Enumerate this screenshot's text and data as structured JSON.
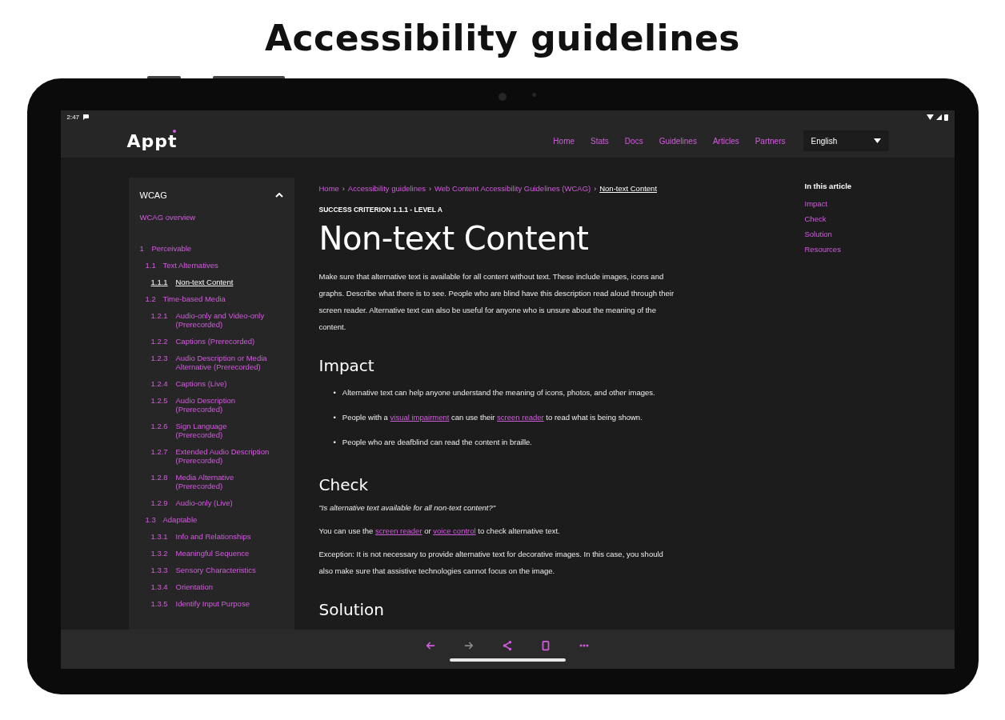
{
  "page_title": "Accessibility guidelines",
  "status_bar": {
    "time": "2:47"
  },
  "header": {
    "logo": "Appt",
    "nav": [
      {
        "label": "Home"
      },
      {
        "label": "Stats"
      },
      {
        "label": "Docs"
      },
      {
        "label": "Guidelines"
      },
      {
        "label": "Articles"
      },
      {
        "label": "Partners"
      }
    ],
    "language": {
      "value": "English"
    }
  },
  "sidebar": {
    "title": "WCAG",
    "expanded": true,
    "overview": {
      "label": "WCAG overview",
      "selected": false
    },
    "items": [
      {
        "number": "1",
        "label": "Perceivable",
        "selected": false,
        "children": [
          {
            "number": "1.1",
            "label": "Text Alternatives",
            "selected": false,
            "children": [
              {
                "number": "1.1.1",
                "label": "Non-text Content",
                "selected": true
              }
            ]
          },
          {
            "number": "1.2",
            "label": "Time-based Media",
            "selected": false,
            "children": [
              {
                "number": "1.2.1",
                "label": "Audio-only and Video-only (Prerecorded)",
                "selected": false
              },
              {
                "number": "1.2.2",
                "label": "Captions (Prerecorded)",
                "selected": false
              },
              {
                "number": "1.2.3",
                "label": "Audio Description or Media Alternative (Prerecorded)",
                "selected": false
              },
              {
                "number": "1.2.4",
                "label": "Captions (Live)",
                "selected": false
              },
              {
                "number": "1.2.5",
                "label": "Audio Description (Prerecorded)",
                "selected": false
              },
              {
                "number": "1.2.6",
                "label": "Sign Language (Prerecorded)",
                "selected": false
              },
              {
                "number": "1.2.7",
                "label": "Extended Audio Description (Prerecorded)",
                "selected": false
              },
              {
                "number": "1.2.8",
                "label": "Media Alternative (Prerecorded)",
                "selected": false
              },
              {
                "number": "1.2.9",
                "label": "Audio-only (Live)",
                "selected": false
              }
            ]
          },
          {
            "number": "1.3",
            "label": "Adaptable",
            "selected": false,
            "children": [
              {
                "number": "1.3.1",
                "label": "Info and Relationships",
                "selected": false
              },
              {
                "number": "1.3.2",
                "label": "Meaningful Sequence",
                "selected": false
              },
              {
                "number": "1.3.3",
                "label": "Sensory Characteristics",
                "selected": false
              },
              {
                "number": "1.3.4",
                "label": "Orientation",
                "selected": false
              },
              {
                "number": "1.3.5",
                "label": "Identify Input Purpose",
                "selected": false
              }
            ]
          }
        ]
      }
    ]
  },
  "breadcrumb": [
    {
      "label": "Home",
      "current": false
    },
    {
      "separator": "›",
      "label": "Accessibility guidelines",
      "current": false
    },
    {
      "separator": "›",
      "label": "Web Content Accessibility Guidelines (WCAG)",
      "current": false
    },
    {
      "separator": "›",
      "label": "Non-text Content",
      "current": true
    }
  ],
  "eyebrow": "SUCCESS CRITERION 1.1.1 - LEVEL A",
  "title": "Non-text Content",
  "blocks": [
    {
      "kind": "paragraph",
      "parts": [
        {
          "text": "Make sure that alternative text is available for all content without text. These include images, icons and graphs. Describe what there is to see. People who are blind have this description read aloud through their screen reader. Alternative text can also be useful for anyone who is unsure about the meaning of the content.",
          "link": false
        }
      ]
    },
    {
      "kind": "heading",
      "text": "Impact"
    },
    {
      "kind": "bullets",
      "items": [
        {
          "marker": "•",
          "parts": [
            {
              "text": "Alternative text can help anyone understand the meaning of icons, photos, and other images.",
              "link": false
            }
          ]
        },
        {
          "marker": "•",
          "parts": [
            {
              "text": "People with a ",
              "link": false
            },
            {
              "text": "visual impairment",
              "link": true
            },
            {
              "text": " can use their ",
              "link": false
            },
            {
              "text": "screen reader",
              "link": true
            },
            {
              "text": " to read what is being shown.",
              "link": false
            }
          ]
        },
        {
          "marker": "•",
          "parts": [
            {
              "text": "People who are deafblind can read the content in braille.",
              "link": false
            }
          ]
        }
      ]
    },
    {
      "kind": "heading",
      "text": "Check"
    },
    {
      "kind": "quote",
      "parts": [
        {
          "text": "\"Is alternative text available for all non-text content?\"",
          "link": false
        }
      ]
    },
    {
      "kind": "paragraph",
      "parts": [
        {
          "text": "You can use the ",
          "link": false
        },
        {
          "text": "screen reader",
          "link": true
        },
        {
          "text": " or ",
          "link": false
        },
        {
          "text": "voice control",
          "link": true
        },
        {
          "text": " to check alternative text.",
          "link": false
        }
      ]
    },
    {
      "kind": "paragraph",
      "parts": [
        {
          "text": "Exception: It is not necessary to provide alternative text for decorative images. In this case, you should also make sure that assistive technologies cannot focus on the image.",
          "link": false
        }
      ]
    },
    {
      "kind": "heading",
      "text": "Solution"
    }
  ],
  "toc": {
    "title": "In this article",
    "links": [
      {
        "label": "Impact"
      },
      {
        "label": "Check"
      },
      {
        "label": "Solution"
      },
      {
        "label": "Resources"
      }
    ]
  },
  "browser_toolbar": [
    {
      "kind": "back",
      "disabled": false
    },
    {
      "kind": "forward",
      "disabled": true
    },
    {
      "kind": "share",
      "disabled": false
    },
    {
      "kind": "tabs",
      "disabled": false
    },
    {
      "kind": "more",
      "disabled": false
    }
  ]
}
